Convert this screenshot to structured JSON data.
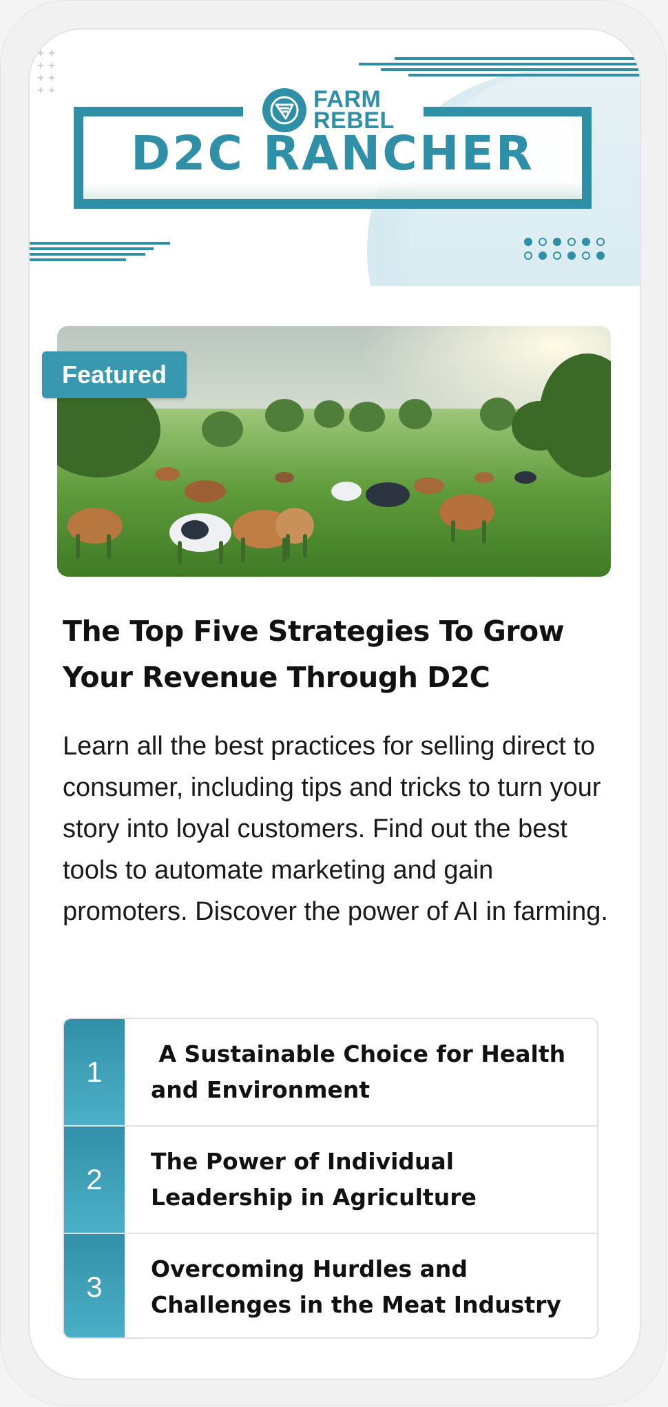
{
  "brand": {
    "logo_line1": "FARM",
    "logo_line2": "REBEL",
    "banner_title": "D2C RANCHER",
    "accent_color": "#2e8fa6"
  },
  "featured": {
    "badge": "Featured",
    "image_subject": "cows grazing in a green pasture at sunrise"
  },
  "article": {
    "title": "The Top Five Strategies To Grow Your Revenue Through D2C",
    "description": "Learn all the best practices for selling direct to consumer, including tips and tricks to turn your story into loyal customers. Find out the best tools to automate marketing and gain promoters. Discover the power of AI in farming."
  },
  "topics": [
    {
      "number": "1",
      "label": " A Sustainable Choice for Health and Environment"
    },
    {
      "number": "2",
      "label": "The Power of Individual Leadership in Agriculture"
    },
    {
      "number": "3",
      "label": "Overcoming Hurdles and Challenges in the Meat Industry"
    }
  ]
}
